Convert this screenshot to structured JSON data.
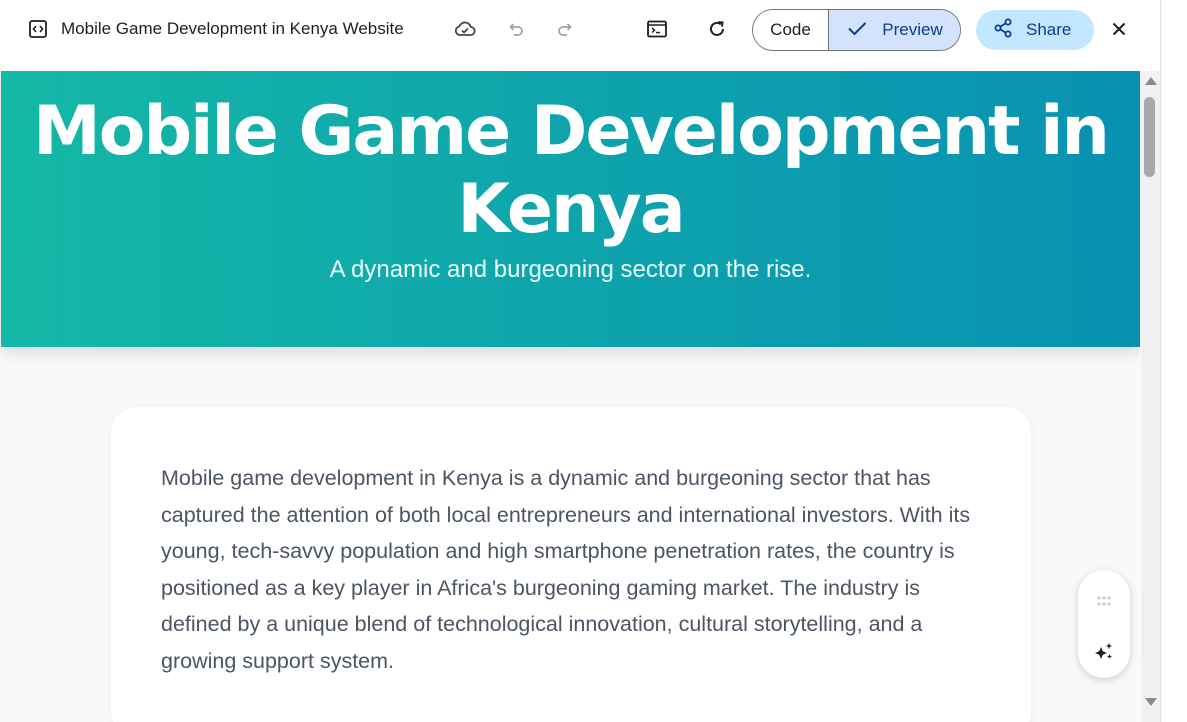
{
  "topbar": {
    "title": "Mobile Game Development in Kenya Website",
    "code_label": "Code",
    "preview_label": "Preview",
    "share_label": "Share",
    "icons": [
      "code-file-icon",
      "cloud-save-icon",
      "undo-icon",
      "redo-icon",
      "terminal-icon",
      "refresh-icon",
      "check-icon",
      "share-icon",
      "close-icon"
    ]
  },
  "hero": {
    "title": "Mobile Game Development in Kenya",
    "subtitle": "A dynamic and burgeoning sector on the rise.",
    "gradient_start": "#14b8a6",
    "gradient_end": "#0891b2"
  },
  "card": {
    "paragraph": "Mobile game development in Kenya is a dynamic and burgeoning sector that has captured the attention of both local entrepreneurs and international investors. With its young, tech-savvy population and high smartphone penetration rates, the country is positioned as a key player in Africa's burgeoning gaming market. The industry is defined by a unique blend of technological innovation, cultural storytelling, and a growing support system."
  },
  "floating_toolbar": {
    "icons": [
      "drag-handle-icon",
      "sparkle-edit-icon"
    ]
  },
  "colors": {
    "preview_active_bg": "#d3e3fd",
    "share_bg": "#c2e7ff",
    "accent_text": "#0b3d91"
  }
}
